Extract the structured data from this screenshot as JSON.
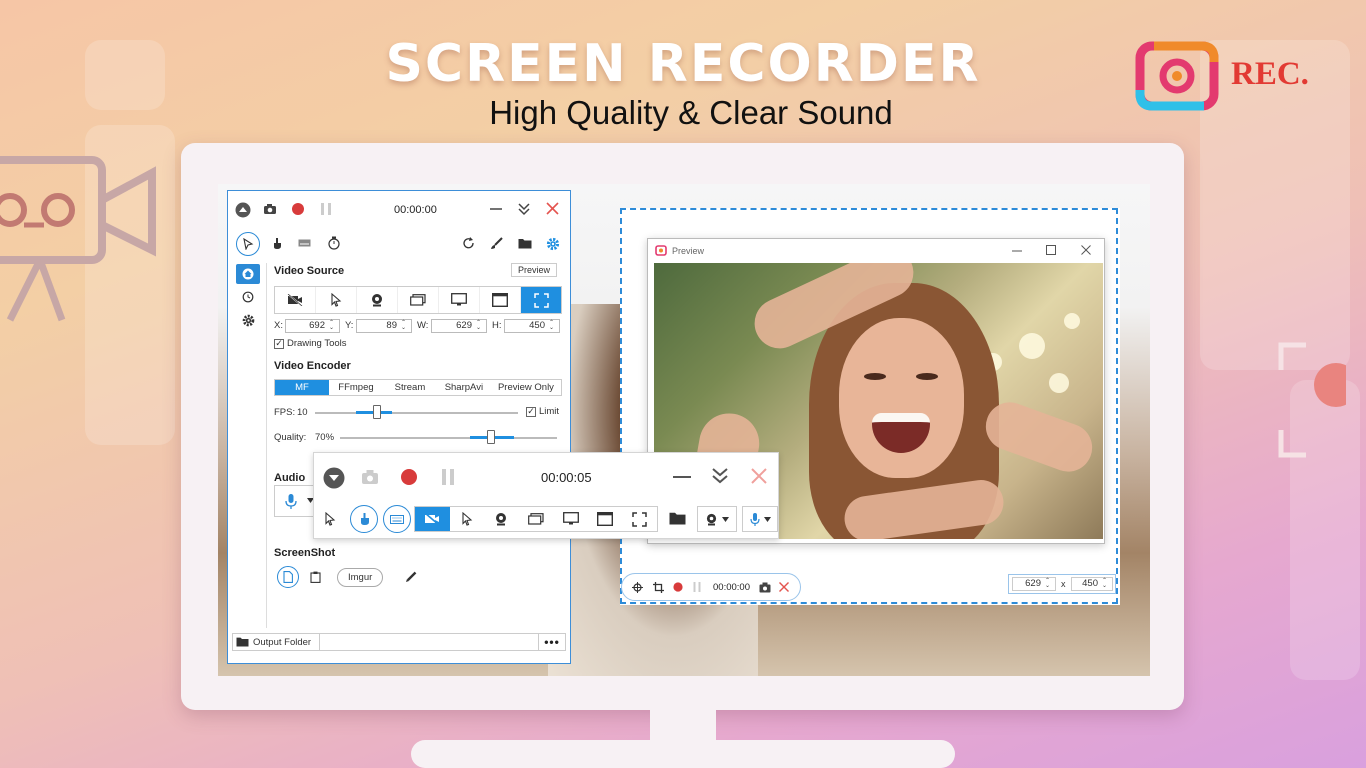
{
  "hero": {
    "title": "SCREEN RECORDER",
    "subtitle": "High Quality & Clear Sound"
  },
  "logo": {
    "text": "REC.",
    "colors": [
      "#f08a2a",
      "#e33a6f",
      "#2fc0e8",
      "#e23a33"
    ]
  },
  "main_window": {
    "timer": "00:00:00",
    "video_source": {
      "title": "Video Source",
      "preview_button": "Preview",
      "icons": [
        "video-off-icon",
        "cursor-icon",
        "webcam-icon",
        "window-icon",
        "screen-icon",
        "app-window-icon",
        "fullscreen-icon"
      ],
      "active_index": 6
    },
    "coords": {
      "x_label": "X:",
      "x": "692",
      "y_label": "Y:",
      "y": "89",
      "w_label": "W:",
      "w": "629",
      "h_label": "H:",
      "h": "450"
    },
    "drawing_tools": "Drawing Tools",
    "video_encoder": {
      "title": "Video Encoder",
      "tabs": [
        "MF",
        "FFmpeg",
        "Stream",
        "SharpAvi",
        "Preview Only"
      ],
      "active_index": 0
    },
    "fps": {
      "label": "FPS:",
      "value": "10",
      "limit_label": "Limit",
      "fraction": 0.3
    },
    "quality": {
      "label": "Quality:",
      "value": "70%",
      "fraction": 0.7
    },
    "audio": {
      "title": "Audio"
    },
    "screenshot": {
      "title": "ScreenShot",
      "imgur": "Imgur"
    },
    "footer": {
      "output_folder": "Output Folder",
      "more": "•••"
    }
  },
  "floating_toolbar": {
    "timer": "00:00:05"
  },
  "preview": {
    "title": "Preview",
    "region_timer": "00:00:00",
    "width": "629",
    "x_sep": "x",
    "height": "450"
  },
  "accent_color": "#1f8fe0",
  "record_color": "#d83b3b"
}
